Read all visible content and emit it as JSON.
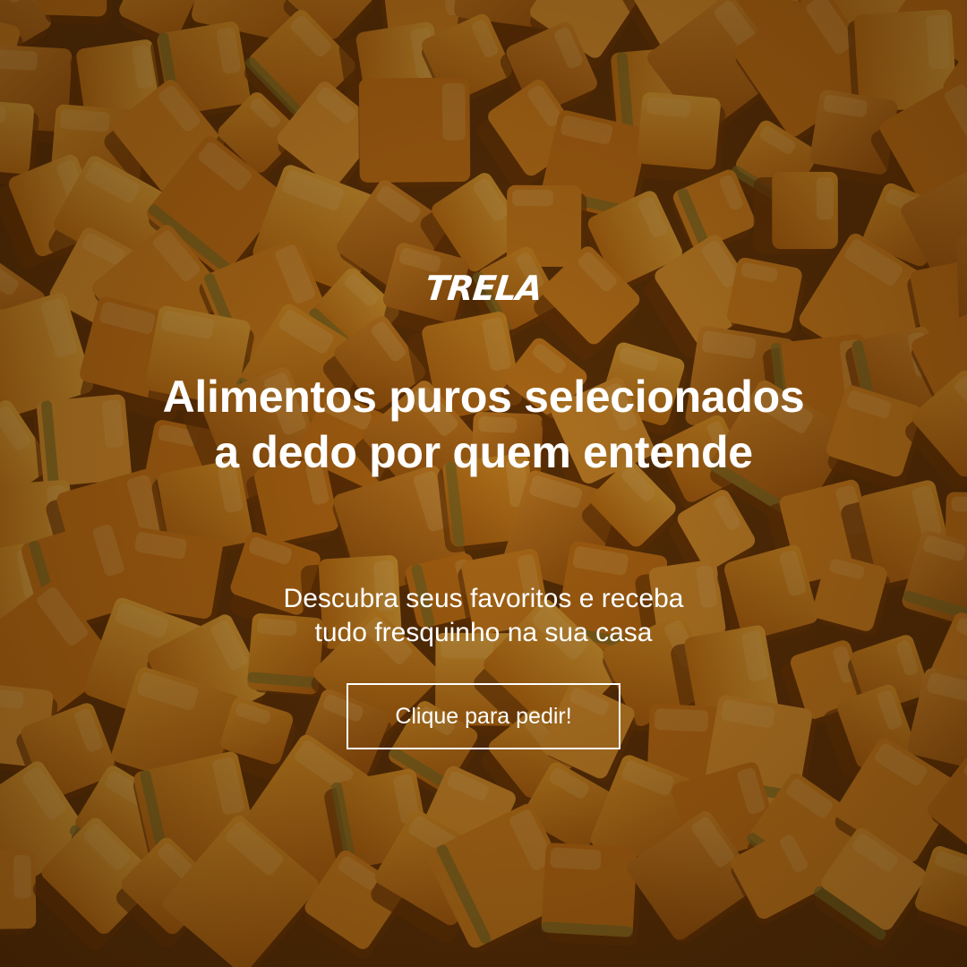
{
  "brand": {
    "logo_text": "TRELA"
  },
  "hero": {
    "headline_line1": "Alimentos puros selecionados",
    "headline_line2": "a dedo por quem entende",
    "subtext_line1": "Descubra seus favoritos e receba",
    "subtext_line2": "tudo fresquinho na sua casa",
    "cta_label": "Clique para pedir!"
  },
  "colors": {
    "text": "#ffffff",
    "food_orange": "#e8941f",
    "food_dark": "#a85a0c",
    "overlay": "#1a0a00"
  },
  "background": {
    "subject": "diced-squash-photo"
  }
}
